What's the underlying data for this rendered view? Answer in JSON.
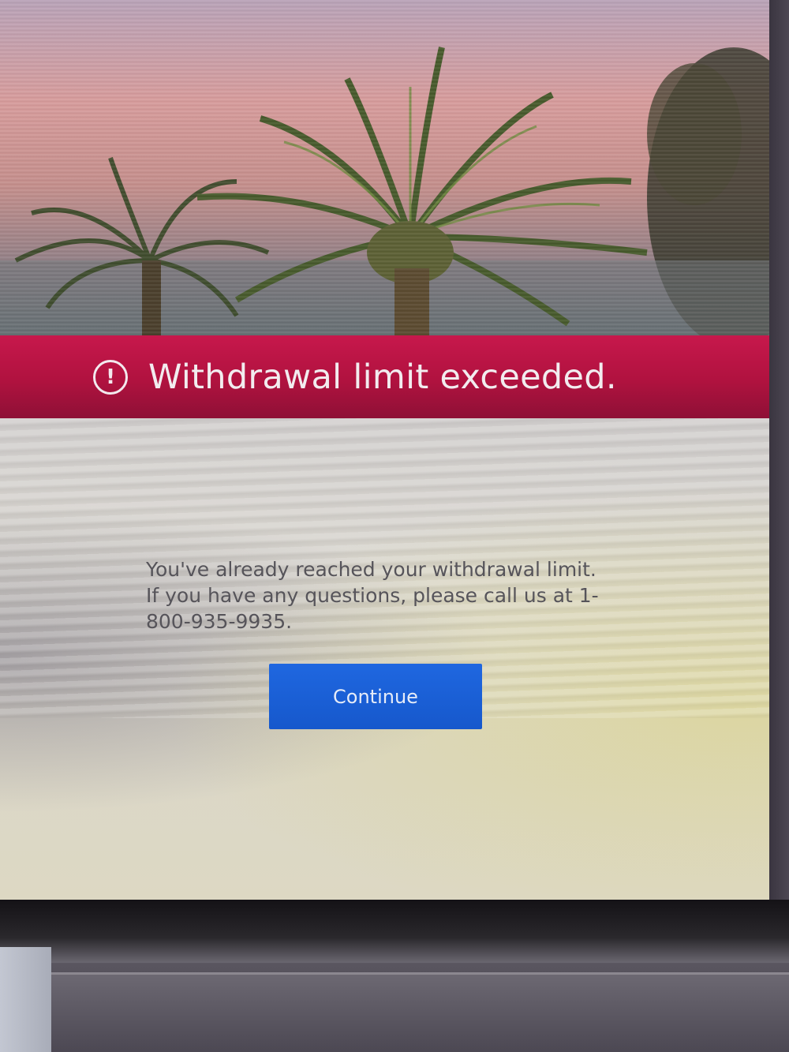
{
  "alert": {
    "icon": "exclamation-circle-icon",
    "title": "Withdrawal limit exceeded."
  },
  "message": {
    "text": "You've already reached your withdrawal limit. If you have any questions, please call us at 1-800-935-9935."
  },
  "actions": {
    "continue_label": "Continue"
  },
  "colors": {
    "banner": "#b0123f",
    "button": "#1a5fd6",
    "panel": "#d9d6cd"
  }
}
